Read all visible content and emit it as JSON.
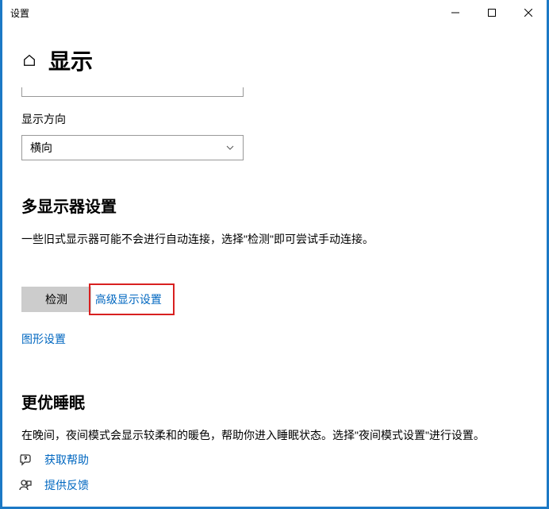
{
  "window": {
    "title": "设置"
  },
  "header": {
    "page_title": "显示"
  },
  "orientation": {
    "label": "显示方向",
    "value": "横向"
  },
  "multi_display": {
    "title": "多显示器设置",
    "desc": "一些旧式显示器可能不会进行自动连接，选择\"检测\"即可尝试手动连接。",
    "detect_button": "检测",
    "advanced_link": "高级显示设置",
    "graphics_link": "图形设置"
  },
  "sleep": {
    "title": "更优睡眠",
    "desc": "在晚间，夜间模式会显示较柔和的暖色，帮助你进入睡眠状态。选择\"夜间模式设置\"进行设置。"
  },
  "footer": {
    "help": "获取帮助",
    "feedback": "提供反馈"
  }
}
